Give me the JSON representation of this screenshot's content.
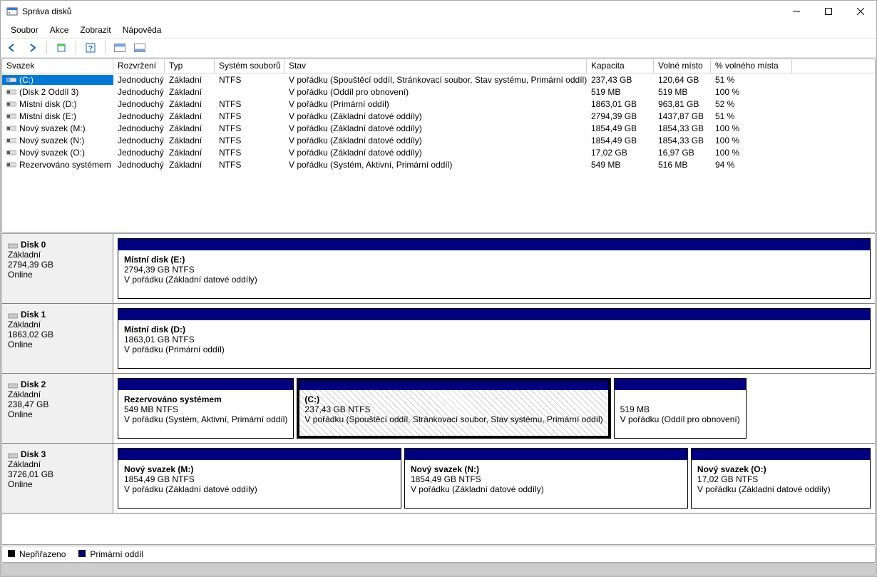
{
  "window": {
    "title": "Správa disků"
  },
  "menu": {
    "items": [
      "Soubor",
      "Akce",
      "Zobrazit",
      "Nápověda"
    ]
  },
  "columns": [
    "Svazek",
    "Rozvržení",
    "Typ",
    "Systém souborů",
    "Stav",
    "Kapacita",
    "Volné místo",
    "% volného místa"
  ],
  "volumes": [
    {
      "name": "(C:)",
      "layout": "Jednoduchý",
      "type": "Základní",
      "fs": "NTFS",
      "status": "V pořádku (Spouštěcí oddíl, Stránkovací soubor, Stav systému, Primární oddíl)",
      "capacity": "237,43 GB",
      "free": "120,64 GB",
      "pct": "51 %",
      "selected": true,
      "iconColor": "#3aa0ff"
    },
    {
      "name": "(Disk 2 Oddíl 3)",
      "layout": "Jednoduchý",
      "type": "Základní",
      "fs": "",
      "status": "V pořádku (Oddíl pro obnovení)",
      "capacity": "519 MB",
      "free": "519 MB",
      "pct": "100 %",
      "iconColor": "#555"
    },
    {
      "name": "Místní disk (D:)",
      "layout": "Jednoduchý",
      "type": "Základní",
      "fs": "NTFS",
      "status": "V pořádku (Primární oddíl)",
      "capacity": "1863,01 GB",
      "free": "963,81 GB",
      "pct": "52 %",
      "iconColor": "#555"
    },
    {
      "name": "Místní disk (E:)",
      "layout": "Jednoduchý",
      "type": "Základní",
      "fs": "NTFS",
      "status": "V pořádku (Základní datové oddíly)",
      "capacity": "2794,39 GB",
      "free": "1437,87 GB",
      "pct": "51 %",
      "iconColor": "#555"
    },
    {
      "name": "Nový svazek (M:)",
      "layout": "Jednoduchý",
      "type": "Základní",
      "fs": "NTFS",
      "status": "V pořádku (Základní datové oddíly)",
      "capacity": "1854,49 GB",
      "free": "1854,33 GB",
      "pct": "100 %",
      "iconColor": "#555"
    },
    {
      "name": "Nový svazek (N:)",
      "layout": "Jednoduchý",
      "type": "Základní",
      "fs": "NTFS",
      "status": "V pořádku (Základní datové oddíly)",
      "capacity": "1854,49 GB",
      "free": "1854,33 GB",
      "pct": "100 %",
      "iconColor": "#555"
    },
    {
      "name": "Nový svazek (O:)",
      "layout": "Jednoduchý",
      "type": "Základní",
      "fs": "NTFS",
      "status": "V pořádku (Základní datové oddíly)",
      "capacity": "17,02 GB",
      "free": "16,97 GB",
      "pct": "100 %",
      "iconColor": "#555"
    },
    {
      "name": "Rezervováno systémem",
      "layout": "Jednoduchý",
      "type": "Základní",
      "fs": "NTFS",
      "status": "V pořádku (Systém, Aktivní, Primární oddíl)",
      "capacity": "549 MB",
      "free": "516 MB",
      "pct": "94 %",
      "iconColor": "#555"
    }
  ],
  "disks": [
    {
      "name": "Disk 0",
      "type": "Základní",
      "size": "2794,39 GB",
      "state": "Online",
      "parts": [
        {
          "name": "Místní disk  (E:)",
          "line2": "2794,39 GB NTFS",
          "line3": "V pořádku (Základní datové oddíly)",
          "flex": 1
        }
      ]
    },
    {
      "name": "Disk 1",
      "type": "Základní",
      "size": "1863,02 GB",
      "state": "Online",
      "parts": [
        {
          "name": "Místní disk  (D:)",
          "line2": "1863,01 GB NTFS",
          "line3": "V pořádku (Primární oddíl)",
          "flex": 1
        }
      ]
    },
    {
      "name": "Disk 2",
      "type": "Základní",
      "size": "238,47 GB",
      "state": "Online",
      "parts": [
        {
          "name": "Rezervováno systémem",
          "line2": "549 MB NTFS",
          "line3": "V pořádku (Systém, Aktivní, Primární oddíl)",
          "flex": 0.21
        },
        {
          "name": "(C:)",
          "line2": "237,43 GB NTFS",
          "line3": "V pořádku (Spouštěcí oddíl, Stránkovací soubor, Stav systému, Primární oddíl)",
          "flex": 0.41,
          "hatch": true,
          "selected": true
        },
        {
          "name": "",
          "line2": "519 MB",
          "line3": "V pořádku (Oddíl pro obnovení)",
          "flex": 0.21
        }
      ]
    },
    {
      "name": "Disk 3",
      "type": "Základní",
      "size": "3726,01 GB",
      "state": "Online",
      "parts": [
        {
          "name": "Nový svazek  (M:)",
          "line2": "1854,49 GB NTFS",
          "line3": "V pořádku (Základní datové oddíly)",
          "flex": 0.38
        },
        {
          "name": "Nový svazek  (N:)",
          "line2": "1854,49 GB NTFS",
          "line3": "V pořádku (Základní datové oddíly)",
          "flex": 0.38
        },
        {
          "name": "Nový svazek  (O:)",
          "line2": "17,02 GB NTFS",
          "line3": "V pořádku (Základní datové oddíly)",
          "flex": 0.24
        }
      ]
    }
  ],
  "legend": {
    "unalloc": "Nepřiřazeno",
    "primary": "Primární oddíl"
  }
}
